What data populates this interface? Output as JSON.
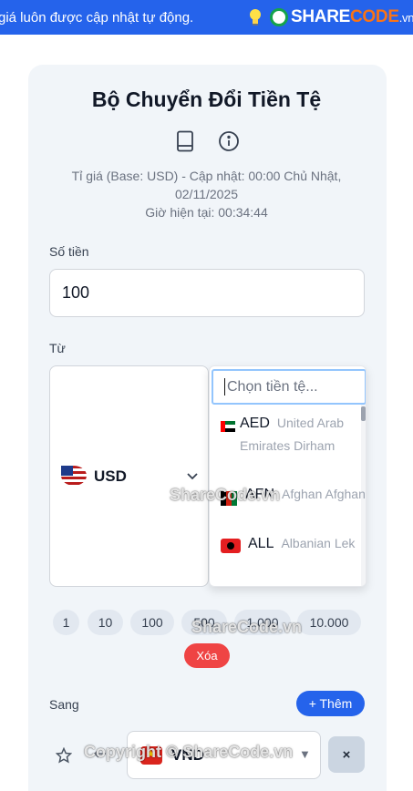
{
  "banner": {
    "text": "giá luôn được cập nhật tự động.",
    "logo_share": "SHARE",
    "logo_code": "CODE",
    "logo_vn": ".vn"
  },
  "header": {
    "title": "Bộ Chuyển Đổi Tiền Tệ",
    "rate_info": "Tỉ giá (Base: USD) - Cập nhật: 00:00 Chủ Nhật, 02/11/2025",
    "current_time": "Giờ hiện tại: 00:34:44"
  },
  "amount": {
    "label": "Số tiền",
    "value": "100"
  },
  "from": {
    "label": "Từ",
    "code": "USD",
    "search_placeholder": "Chọn tiền tệ...",
    "options": [
      {
        "code": "AED",
        "name": "United Arab Emirates Dirham"
      },
      {
        "code": "AFN",
        "name": "Afghan Afghani"
      },
      {
        "code": "ALL",
        "name": "Albanian Lek"
      }
    ]
  },
  "quick_amounts": [
    "1",
    "10",
    "100",
    "500",
    "1.000",
    "10.000"
  ],
  "clear_label": "Xóa",
  "to": {
    "label": "Sang",
    "add_label": "+ Thêm",
    "code": "VND",
    "remove_label": "×"
  },
  "watermarks": [
    "ShareCode.vn",
    "ShareCode.vn",
    "Copyright © ShareCode.vn"
  ],
  "colors": {
    "primary": "#2563eb",
    "danger": "#ef4444",
    "card": "#f1f5f9"
  }
}
